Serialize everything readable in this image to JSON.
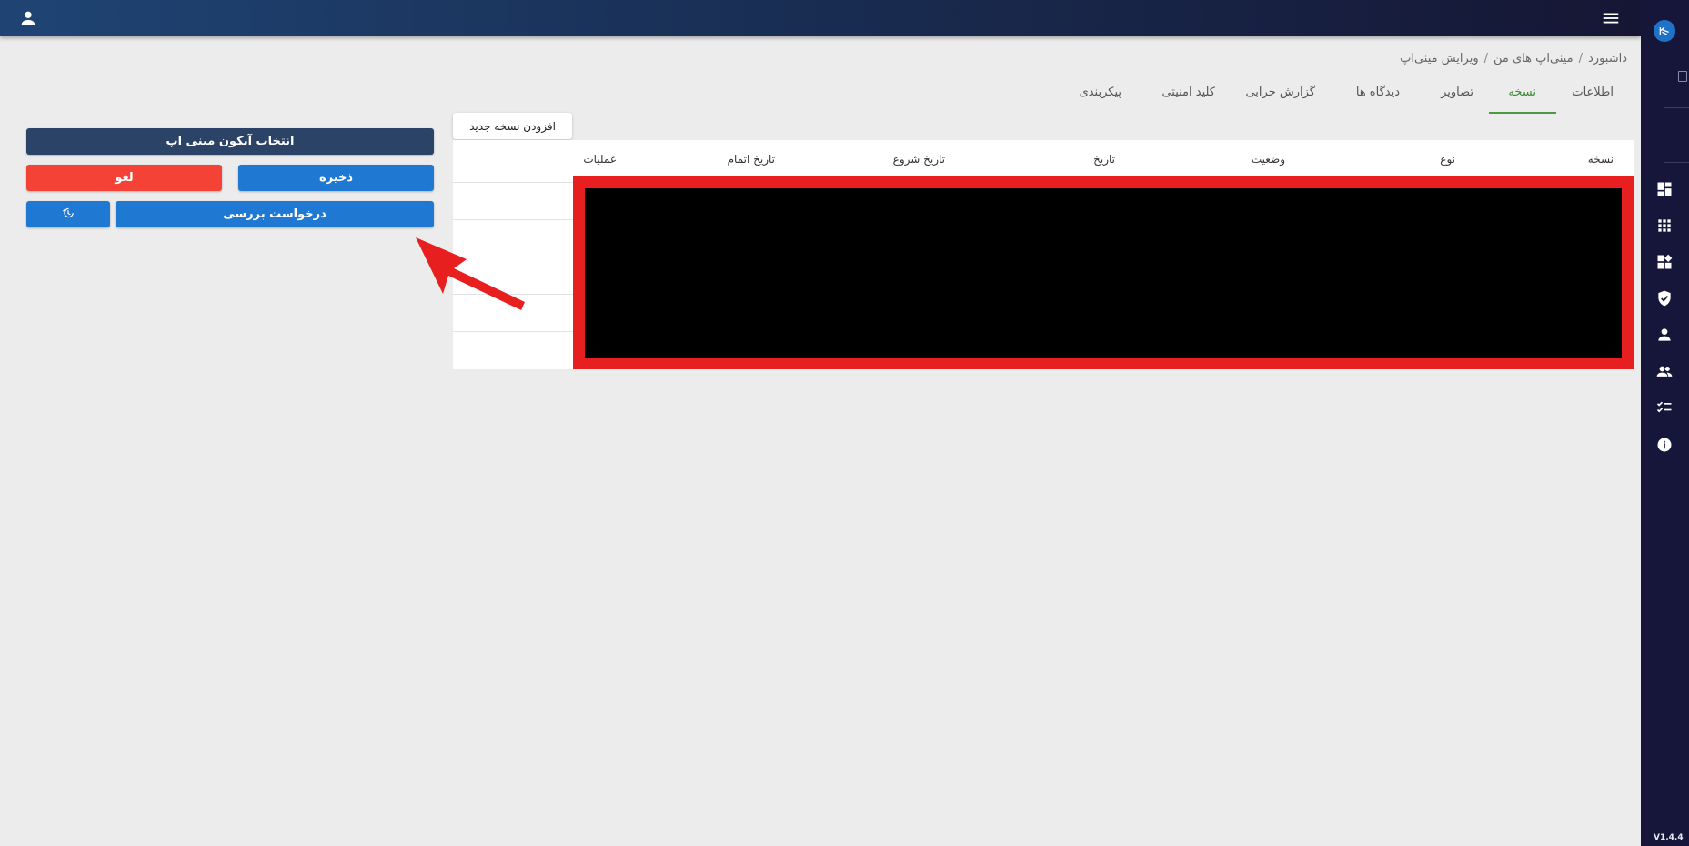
{
  "header": {
    "user_icon": "user-icon",
    "menu_icon": "hamburger-menu-icon"
  },
  "sidebar": {
    "logo_icon": "app-logo-icon",
    "items": [
      {
        "icon": "dashboard-icon"
      },
      {
        "icon": "apps-grid-icon"
      },
      {
        "icon": "widgets-icon"
      },
      {
        "icon": "verified-shield-icon"
      },
      {
        "icon": "person-icon"
      },
      {
        "icon": "group-icon"
      },
      {
        "icon": "checklist-icon"
      },
      {
        "icon": "info-icon"
      }
    ],
    "version": "V1.4.4"
  },
  "breadcrumb": {
    "items": [
      "داشبورد",
      "مینی‌اپ های من",
      "ویرایش مینی‌اپ"
    ],
    "separator": "/"
  },
  "tabs": {
    "info": "اطلاعات",
    "version": "نسخه",
    "images": "تصاویر",
    "reviews": "دیدگاه ها",
    "bug_report": "گزارش خرابی",
    "security_key": "کلید امنیتی",
    "config": "پیکربندی",
    "active": "نسخه"
  },
  "actions": {
    "select_icon": "انتخاب آیکون مینی اپ",
    "save": "ذخیره",
    "cancel": "لغو",
    "request_review": "درخواست بررسی",
    "history_icon": "history-icon"
  },
  "table": {
    "add_button": "افزودن نسخه جدید",
    "columns": {
      "version": "نسخه",
      "type": "نوع",
      "status": "وضعیت",
      "date": "تاریخ",
      "start_date": "تاریخ شروع",
      "end_date": "تاریخ اتمام",
      "operations": "عملیات"
    }
  },
  "colors": {
    "accent_green": "#4a9a42",
    "primary_blue": "#1f78d1",
    "danger_red": "#f44336",
    "dark_button": "#2b4366",
    "sidebar_bg": "#16163a"
  }
}
